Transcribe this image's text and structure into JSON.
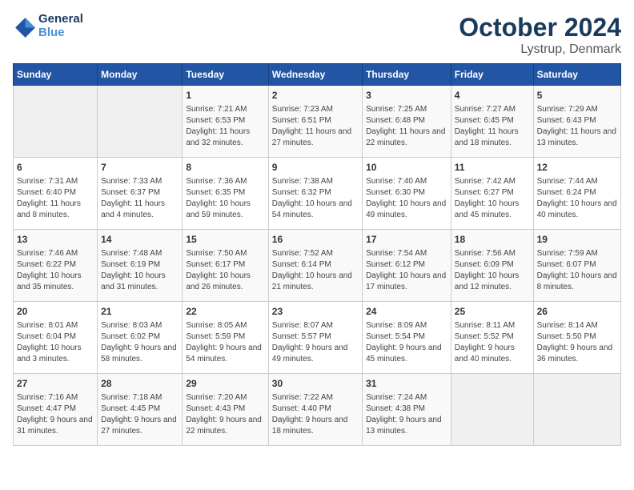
{
  "header": {
    "logo": "GeneralBlue",
    "month": "October 2024",
    "location": "Lystrup, Denmark"
  },
  "weekdays": [
    "Sunday",
    "Monday",
    "Tuesday",
    "Wednesday",
    "Thursday",
    "Friday",
    "Saturday"
  ],
  "weeks": [
    [
      {
        "day": "",
        "info": ""
      },
      {
        "day": "",
        "info": ""
      },
      {
        "day": "1",
        "info": "Sunrise: 7:21 AM\nSunset: 6:53 PM\nDaylight: 11 hours and 32 minutes."
      },
      {
        "day": "2",
        "info": "Sunrise: 7:23 AM\nSunset: 6:51 PM\nDaylight: 11 hours and 27 minutes."
      },
      {
        "day": "3",
        "info": "Sunrise: 7:25 AM\nSunset: 6:48 PM\nDaylight: 11 hours and 22 minutes."
      },
      {
        "day": "4",
        "info": "Sunrise: 7:27 AM\nSunset: 6:45 PM\nDaylight: 11 hours and 18 minutes."
      },
      {
        "day": "5",
        "info": "Sunrise: 7:29 AM\nSunset: 6:43 PM\nDaylight: 11 hours and 13 minutes."
      }
    ],
    [
      {
        "day": "6",
        "info": "Sunrise: 7:31 AM\nSunset: 6:40 PM\nDaylight: 11 hours and 8 minutes."
      },
      {
        "day": "7",
        "info": "Sunrise: 7:33 AM\nSunset: 6:37 PM\nDaylight: 11 hours and 4 minutes."
      },
      {
        "day": "8",
        "info": "Sunrise: 7:36 AM\nSunset: 6:35 PM\nDaylight: 10 hours and 59 minutes."
      },
      {
        "day": "9",
        "info": "Sunrise: 7:38 AM\nSunset: 6:32 PM\nDaylight: 10 hours and 54 minutes."
      },
      {
        "day": "10",
        "info": "Sunrise: 7:40 AM\nSunset: 6:30 PM\nDaylight: 10 hours and 49 minutes."
      },
      {
        "day": "11",
        "info": "Sunrise: 7:42 AM\nSunset: 6:27 PM\nDaylight: 10 hours and 45 minutes."
      },
      {
        "day": "12",
        "info": "Sunrise: 7:44 AM\nSunset: 6:24 PM\nDaylight: 10 hours and 40 minutes."
      }
    ],
    [
      {
        "day": "13",
        "info": "Sunrise: 7:46 AM\nSunset: 6:22 PM\nDaylight: 10 hours and 35 minutes."
      },
      {
        "day": "14",
        "info": "Sunrise: 7:48 AM\nSunset: 6:19 PM\nDaylight: 10 hours and 31 minutes."
      },
      {
        "day": "15",
        "info": "Sunrise: 7:50 AM\nSunset: 6:17 PM\nDaylight: 10 hours and 26 minutes."
      },
      {
        "day": "16",
        "info": "Sunrise: 7:52 AM\nSunset: 6:14 PM\nDaylight: 10 hours and 21 minutes."
      },
      {
        "day": "17",
        "info": "Sunrise: 7:54 AM\nSunset: 6:12 PM\nDaylight: 10 hours and 17 minutes."
      },
      {
        "day": "18",
        "info": "Sunrise: 7:56 AM\nSunset: 6:09 PM\nDaylight: 10 hours and 12 minutes."
      },
      {
        "day": "19",
        "info": "Sunrise: 7:59 AM\nSunset: 6:07 PM\nDaylight: 10 hours and 8 minutes."
      }
    ],
    [
      {
        "day": "20",
        "info": "Sunrise: 8:01 AM\nSunset: 6:04 PM\nDaylight: 10 hours and 3 minutes."
      },
      {
        "day": "21",
        "info": "Sunrise: 8:03 AM\nSunset: 6:02 PM\nDaylight: 9 hours and 58 minutes."
      },
      {
        "day": "22",
        "info": "Sunrise: 8:05 AM\nSunset: 5:59 PM\nDaylight: 9 hours and 54 minutes."
      },
      {
        "day": "23",
        "info": "Sunrise: 8:07 AM\nSunset: 5:57 PM\nDaylight: 9 hours and 49 minutes."
      },
      {
        "day": "24",
        "info": "Sunrise: 8:09 AM\nSunset: 5:54 PM\nDaylight: 9 hours and 45 minutes."
      },
      {
        "day": "25",
        "info": "Sunrise: 8:11 AM\nSunset: 5:52 PM\nDaylight: 9 hours and 40 minutes."
      },
      {
        "day": "26",
        "info": "Sunrise: 8:14 AM\nSunset: 5:50 PM\nDaylight: 9 hours and 36 minutes."
      }
    ],
    [
      {
        "day": "27",
        "info": "Sunrise: 7:16 AM\nSunset: 4:47 PM\nDaylight: 9 hours and 31 minutes."
      },
      {
        "day": "28",
        "info": "Sunrise: 7:18 AM\nSunset: 4:45 PM\nDaylight: 9 hours and 27 minutes."
      },
      {
        "day": "29",
        "info": "Sunrise: 7:20 AM\nSunset: 4:43 PM\nDaylight: 9 hours and 22 minutes."
      },
      {
        "day": "30",
        "info": "Sunrise: 7:22 AM\nSunset: 4:40 PM\nDaylight: 9 hours and 18 minutes."
      },
      {
        "day": "31",
        "info": "Sunrise: 7:24 AM\nSunset: 4:38 PM\nDaylight: 9 hours and 13 minutes."
      },
      {
        "day": "",
        "info": ""
      },
      {
        "day": "",
        "info": ""
      }
    ]
  ]
}
